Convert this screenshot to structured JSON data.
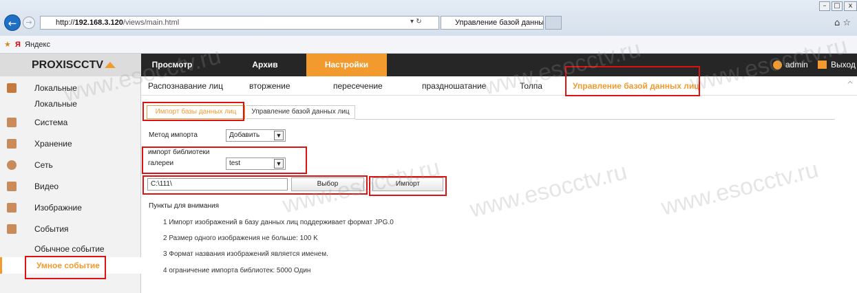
{
  "browser": {
    "url_prefix": "http://",
    "url_host": "192.168.3.120",
    "url_path": "/views/main.html",
    "tab_title": "Управление базой данных...",
    "tab_close": "×",
    "favorites_item": "Яндекс"
  },
  "header": {
    "logo": "PROXISCCTV",
    "nav": [
      "Просмотр",
      "Архив",
      "Настройки"
    ],
    "user": "admin",
    "logout": "Выход"
  },
  "subnav": [
    "Распознавание лиц",
    "вторжение",
    "пересечение",
    "праздношатание",
    "Толпа",
    "Управление базой данных лиц"
  ],
  "sidebar": {
    "items": [
      "Локальные",
      "Система",
      "Хранение",
      "Сеть",
      "Видео",
      "Изображние",
      "События"
    ],
    "sub_local": "Локальные",
    "sub_events": [
      "Обычное событие",
      "Умное событие"
    ]
  },
  "content": {
    "tabs": [
      "Импорт базы данных лиц",
      "Управление базой данных лиц"
    ],
    "method_label": "Метод импорта",
    "method_value": "Добавить",
    "library_label1": "импорт библиотеки",
    "library_label2": "галереи",
    "library_value": "test",
    "path_value": "C:\\111\\",
    "browse_button": "Выбор",
    "import_button": "Импорт",
    "notes_title": "Пункты для внимания",
    "notes": [
      "1 Импорт изображений в базу данных лиц поддерживает формат JPG.0",
      "2 Размер одного изображения не больше: 100 K",
      "3 Формат названия изображений является именем.",
      "4 ограничение импорта библиотек: 5000 Один"
    ]
  },
  "watermark": "www.esocctv.ru",
  "colors": {
    "accent": "#f39a2e",
    "highlight": "#d11111",
    "nav_bg": "#262626"
  }
}
